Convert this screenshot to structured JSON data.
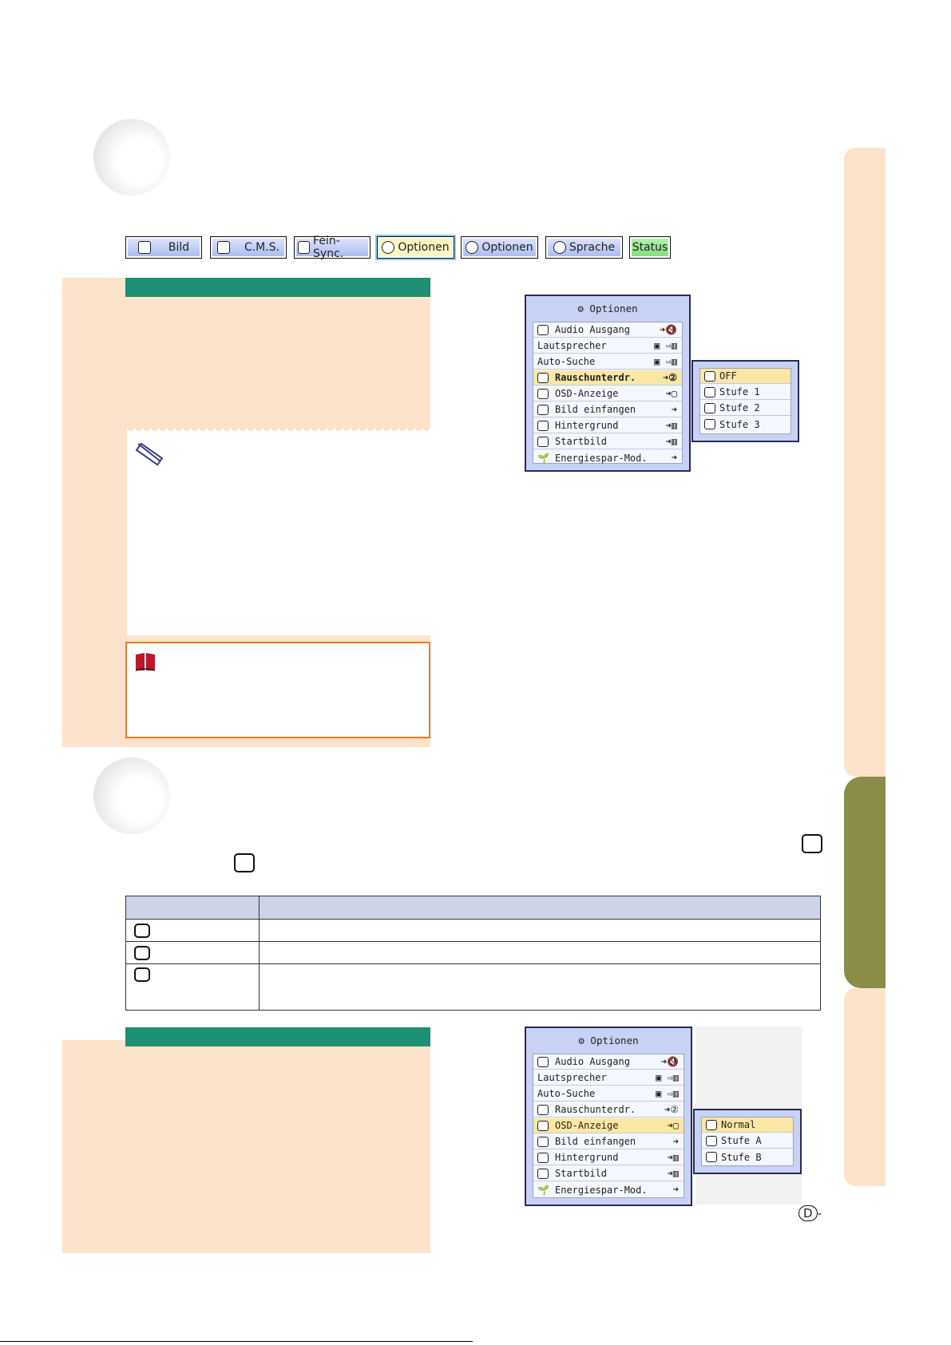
{
  "tabs": [
    {
      "label": "Bild",
      "icon": "picture-icon"
    },
    {
      "label": "C.M.S.",
      "icon": "cms-icon"
    },
    {
      "label": "Fein-Sync.",
      "icon": "fine-sync-icon"
    },
    {
      "label": "Optionen",
      "icon": "options1-icon"
    },
    {
      "label": "Optionen",
      "icon": "options2-icon"
    },
    {
      "label": "Sprache",
      "icon": "speech-bubble-icon"
    },
    {
      "label": "Status",
      "icon": ""
    }
  ],
  "osd1": {
    "title": "Optionen",
    "rows": [
      {
        "label": "Audio Ausgang",
        "value": "➜🔇",
        "icon": true
      },
      {
        "label": "Lautsprecher",
        "value": "▣ ⇨▥",
        "icon": false
      },
      {
        "label": "Auto-Suche",
        "value": "▣ ⇨▥",
        "icon": false
      },
      {
        "label": "Rauschunterdr.",
        "value": "➜②",
        "icon": true
      },
      {
        "label": "OSD-Anzeige",
        "value": "➜▢",
        "icon": true
      },
      {
        "label": "Bild einfangen",
        "value": "➜",
        "icon": true
      },
      {
        "label": "Hintergrund",
        "value": "➜▥",
        "icon": true
      },
      {
        "label": "Startbild",
        "value": "➜▥",
        "icon": true
      },
      {
        "label": "Energiespar-Mod.",
        "value": "➜",
        "icon": true
      }
    ],
    "submenu": [
      "OFF",
      "Stufe 1",
      "Stufe 2",
      "Stufe 3"
    ]
  },
  "osd2": {
    "title": "Optionen",
    "rows": [
      {
        "label": "Audio Ausgang",
        "value": "➜🔇",
        "icon": true
      },
      {
        "label": "Lautsprecher",
        "value": "▣ ⇨▥",
        "icon": false
      },
      {
        "label": "Auto-Suche",
        "value": "▣ ⇨▥",
        "icon": false
      },
      {
        "label": "Rauschunterdr.",
        "value": "➜②",
        "icon": true
      },
      {
        "label": "OSD-Anzeige",
        "value": "➜▢",
        "icon": true
      },
      {
        "label": "Bild einfangen",
        "value": "➜",
        "icon": true
      },
      {
        "label": "Hintergrund",
        "value": "➜▥",
        "icon": true
      },
      {
        "label": "Startbild",
        "value": "➜▥",
        "icon": true
      },
      {
        "label": "Energiespar-Mod.",
        "value": "➜",
        "icon": true
      }
    ],
    "submenu": [
      "Normal",
      "Stufe A",
      "Stufe B"
    ]
  },
  "page_marker": "D-",
  "colors": {
    "peach": "#fde3cc",
    "green_bar": "#1d8f72",
    "olive_tab": "#8a8c47",
    "warn_border": "#f07a1e"
  }
}
